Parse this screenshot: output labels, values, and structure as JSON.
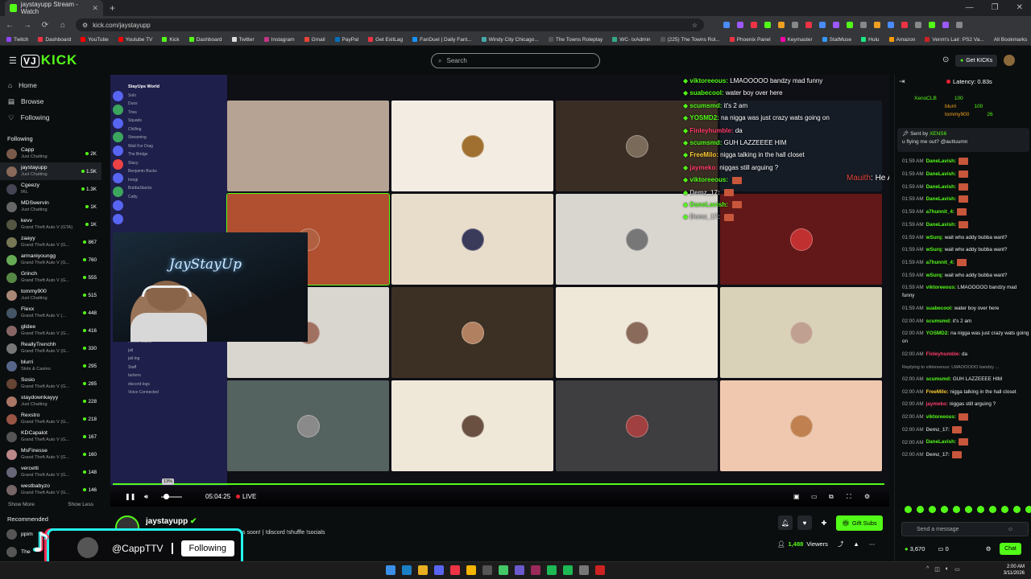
{
  "browser": {
    "tab_title": "jaystayupp Stream - Watch",
    "url": "kick.com/jaystayupp",
    "bookmarks": [
      "Twitch",
      "Dashboard",
      "YouTube",
      "Youtube TV",
      "Kick",
      "Dashboard",
      "Twitter",
      "Instagram",
      "Gmail",
      "PayPal",
      "Get ExitLag",
      "FanDuel | Daily Fant...",
      "Windy City Chicago...",
      "The Towns Roleplay",
      "WC- txAdmin",
      "(225) The Towns Rol...",
      "Phoenix Panel",
      "Keymaster",
      "StatMuse",
      "Hulu",
      "Amazon",
      "Venm's Lair: PS2 Va..."
    ],
    "all_bookmarks": "All Bookmarks"
  },
  "header": {
    "logo": "KICK",
    "logo_box": "VJ",
    "search_placeholder": "Search",
    "get_kicks": "Get KICKs"
  },
  "sidebar": {
    "nav": [
      {
        "label": "Home",
        "icon": "home-icon"
      },
      {
        "label": "Browse",
        "icon": "browse-icon"
      },
      {
        "label": "Following",
        "icon": "heart-icon"
      }
    ],
    "following_title": "Following",
    "following": [
      {
        "name": "Capp",
        "game": "Just Chatting",
        "viewers": "2K"
      },
      {
        "name": "jaystayupp",
        "game": "Just Chatting",
        "viewers": "1.5K"
      },
      {
        "name": "Cgeezy",
        "game": "IRL",
        "viewers": "1.3K"
      },
      {
        "name": "MDSwervin",
        "game": "Just Chatting",
        "viewers": "1K"
      },
      {
        "name": "kevv",
        "game": "Grand Theft Auto V (GTA)",
        "viewers": "1K"
      },
      {
        "name": "zaayy",
        "game": "Grand Theft Auto V (G...",
        "viewers": "867"
      },
      {
        "name": "armaniyoungg",
        "game": "Grand Theft Auto V (G...",
        "viewers": "760"
      },
      {
        "name": "Grinch",
        "game": "Grand Theft Auto V (G...",
        "viewers": "555"
      },
      {
        "name": "tommy900",
        "game": "Just Chatting",
        "viewers": "515"
      },
      {
        "name": "Flexx",
        "game": "Grand Theft Auto V (...",
        "viewers": "448"
      },
      {
        "name": "glidee",
        "game": "Grand Theft Auto V (G...",
        "viewers": "416"
      },
      {
        "name": "ReallyTrenchh",
        "game": "Grand Theft Auto V (G...",
        "viewers": "330"
      },
      {
        "name": "blurri",
        "game": "Slots & Casino",
        "viewers": "295"
      },
      {
        "name": "Sosio",
        "game": "Grand Theft Auto V (G...",
        "viewers": "285"
      },
      {
        "name": "staydownkayyy",
        "game": "Just Chatting",
        "viewers": "228"
      },
      {
        "name": "Rexstro",
        "game": "Grand Theft Auto V (G...",
        "viewers": "218"
      },
      {
        "name": "KDCapalot",
        "game": "Grand Theft Auto V (G...",
        "viewers": "167"
      },
      {
        "name": "MsFinesse",
        "game": "Grand Theft Auto V (G...",
        "viewers": "160"
      },
      {
        "name": "vercetti",
        "game": "Grand Theft Auto V (G...",
        "viewers": "148"
      },
      {
        "name": "westbabyzo",
        "game": "Grand Theft Auto V (G...",
        "viewers": "146"
      }
    ],
    "show_more": "Show More",
    "show_less": "Show Less",
    "recommended_title": "Recommended",
    "recommended": [
      {
        "name": "ppim"
      },
      {
        "name": "The"
      }
    ]
  },
  "video": {
    "discord_server": "StayUps World",
    "discord_channels": [
      "Solo",
      "Duos",
      "Trios",
      "Squads",
      "Chilling",
      "Streaming",
      "Wait For Drag",
      "The Bridge",
      "Stacy",
      "Benjamin Bucks",
      "Imogi",
      "BubbaStacks",
      "Catty",
      "Voice Channels",
      "interface",
      "Join to Create",
      "AFK",
      "Rivers Island",
      "jail",
      "jail-log",
      "Staff",
      "lackers",
      "discord-logs",
      "Voice Connected"
    ],
    "webcam_sign": "JayStayUp",
    "overlay_chat": [
      {
        "user": "viktoreeous:",
        "text": "LMAOOOOO bandzy mad funny",
        "color": "#53fc18"
      },
      {
        "user": "suabecool:",
        "text": "water boy over here",
        "color": "#53fc18"
      },
      {
        "user": "scumsmd:",
        "text": "it's 2 am",
        "color": "#53fc18"
      },
      {
        "user": "YOSMD2:",
        "text": "na nigga was just crazy wats going on",
        "color": "#53fc18"
      },
      {
        "user": "Finleyhumble:",
        "text": "da",
        "color": "#ff3b6b"
      },
      {
        "user": "scumsmd:",
        "text": "GUH LAZZEEEE HIM",
        "color": "#53fc18"
      },
      {
        "user": "FreeMilo:",
        "text": "nigga talking in the hall closet",
        "color": "#ffcc33"
      },
      {
        "user": "jaymeko:",
        "text": "niggas still arguing ?",
        "color": "#ff3b6b"
      },
      {
        "user": "viktoreeous:",
        "text": "",
        "color": "#53fc18"
      },
      {
        "user": "Demz_17:",
        "text": "",
        "color": "#bbbbbb"
      },
      {
        "user": "DaneLavish:",
        "text": "",
        "color": "#53fc18"
      },
      {
        "user": "Demz_17:",
        "text": "",
        "color": "#bbbbbb"
      }
    ],
    "alert_user": "Mauith",
    "alert_text": ": He A AR LOYAL",
    "time": "05:04:25",
    "live": "LIVE",
    "volume_tip": "13%",
    "volume_fraction": 0.13
  },
  "channel": {
    "name": "jaystayupp",
    "title": "s soon! | !discord !shuffle !socials",
    "gift_subs": "Gift Subs",
    "viewers": "1,488",
    "viewers_label": "Viewers"
  },
  "tiktok": {
    "handle": "@CappTTV",
    "button": "Following"
  },
  "chat": {
    "latency": "Latency: 0.83s",
    "leaderboard": [
      {
        "name": "XenoCLB",
        "value": "100"
      },
      {
        "name": "blurri",
        "value": "100"
      },
      {
        "name": "tommy900",
        "value": "26"
      }
    ],
    "pinned_by": "Sent by",
    "pinned_sender": "XENS6",
    "pinned_text": "u flying me out? @auttuumn",
    "messages": [
      {
        "time": "01:59 AM",
        "user": "DaneLavish:",
        "text": "",
        "color": "#53fc18"
      },
      {
        "time": "01:59 AM",
        "user": "DaneLavish:",
        "text": "",
        "color": "#53fc18"
      },
      {
        "time": "01:59 AM",
        "user": "DaneLavish:",
        "text": "",
        "color": "#53fc18"
      },
      {
        "time": "01:59 AM",
        "user": "DaneLavish:",
        "text": "",
        "color": "#53fc18"
      },
      {
        "time": "01:59 AM",
        "user": "a7hunnit_4:",
        "text": "",
        "color": "#53fc18"
      },
      {
        "time": "01:59 AM",
        "user": "DaneLavish:",
        "text": "",
        "color": "#53fc18"
      },
      {
        "time": "01:59 AM",
        "user": "wSurq:",
        "text": "wait who addy bubba want?",
        "color": "#53fc18"
      },
      {
        "time": "01:59 AM",
        "user": "wSurq:",
        "text": "wait who addy bubba want?",
        "color": "#53fc18"
      },
      {
        "time": "01:59 AM",
        "user": "a7hunnit_4:",
        "text": "",
        "color": "#53fc18"
      },
      {
        "time": "01:59 AM",
        "user": "wSurq:",
        "text": "wait who addy bubba want?",
        "color": "#53fc18"
      },
      {
        "time": "01:59 AM",
        "user": "viktoreeous:",
        "text": "LMAOOOOO bandzy mad funny",
        "color": "#53fc18"
      },
      {
        "time": "01:59 AM",
        "user": "suabecool:",
        "text": "water boy over here",
        "color": "#53fc18"
      },
      {
        "time": "02:00 AM",
        "user": "scumsmd:",
        "text": "it's 2 am",
        "color": "#53fc18"
      },
      {
        "time": "02:00 AM",
        "user": "YOSMD2:",
        "text": "na nigga was just crazy wats going on",
        "color": "#53fc18"
      },
      {
        "time": "02:00 AM",
        "user": "Finleyhumble:",
        "text": "da",
        "color": "#ff3b6b"
      },
      {
        "time": "",
        "user": "Replying to viktoreeous: LMAOOOOO bandzy ...",
        "text": "",
        "color": "#999999"
      },
      {
        "time": "02:00 AM",
        "user": "scumsmd:",
        "text": "GUH LAZZEEEE HIM",
        "color": "#53fc18"
      },
      {
        "time": "02:00 AM",
        "user": "FreeMilo:",
        "text": "nigga talking in the hall closet",
        "color": "#ffcc33"
      },
      {
        "time": "02:00 AM",
        "user": "jaymeko:",
        "text": "niggas still arguing ?",
        "color": "#ff3b6b"
      },
      {
        "time": "02:00 AM",
        "user": "viktoreeous:",
        "text": "",
        "color": "#53fc18"
      },
      {
        "time": "02:00 AM",
        "user": "Demz_17:",
        "text": "",
        "color": "#bbbbbb"
      },
      {
        "time": "02:00 AM",
        "user": "DaneLavish:",
        "text": "",
        "color": "#53fc18"
      },
      {
        "time": "02:00 AM",
        "user": "Demz_17:",
        "text": "",
        "color": "#bbbbbb"
      }
    ],
    "send_placeholder": "Send a message",
    "points": "3,670",
    "zero": "0",
    "chat_button": "Chat"
  },
  "taskbar": {
    "time": "2:00 AM",
    "date": "3/11/2026"
  }
}
